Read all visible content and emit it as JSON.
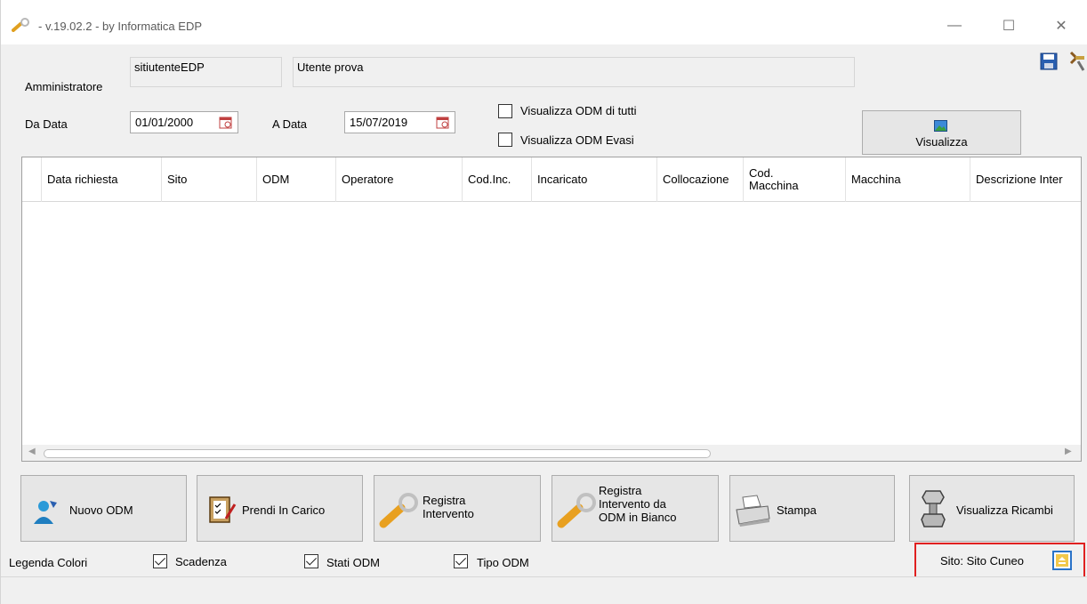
{
  "window": {
    "title": " - v.19.02.2 - by Informatica EDP",
    "controls": {
      "minimize": "—",
      "maximize": "☐",
      "close": "✕"
    }
  },
  "user": {
    "role_label": "Amministratore",
    "username": "sitiutenteEDP",
    "fullname": "Utente prova"
  },
  "filters": {
    "from_label": "Da Data",
    "from_value": "01/01/2000",
    "to_label": "A Data",
    "to_value": "15/07/2019",
    "show_all_label": "Visualizza ODM di tutti",
    "show_all_checked": false,
    "show_closed_label": "Visualizza ODM Evasi",
    "show_closed_checked": false,
    "view_button": "Visualizza"
  },
  "grid": {
    "columns": [
      "Data richiesta",
      "Sito",
      "ODM",
      "Operatore",
      "Cod.Inc.",
      "Incaricato",
      "Collocazione",
      "Cod.\nMacchina",
      "Macchina",
      "Descrizione Inter"
    ],
    "rows": []
  },
  "actions": {
    "new_odm": "Nuovo ODM",
    "take_charge": "Prendi In Carico",
    "register": "Registra\nIntervento",
    "register_blank": "Registra\nIntervento da\nODM in Bianco",
    "print": "Stampa",
    "spare_parts": "Visualizza Ricambi"
  },
  "legend": {
    "label": "Legenda Colori",
    "items": [
      {
        "label": "Scadenza",
        "checked": true
      },
      {
        "label": "Stati ODM",
        "checked": true
      },
      {
        "label": "Tipo ODM",
        "checked": true
      }
    ]
  },
  "site": {
    "label": "Sito: Sito Cuneo"
  },
  "colors": {
    "accent_blue": "#2a73c8",
    "highlight_red": "#e02020",
    "site_icon_yellow": "#f2c84b"
  }
}
